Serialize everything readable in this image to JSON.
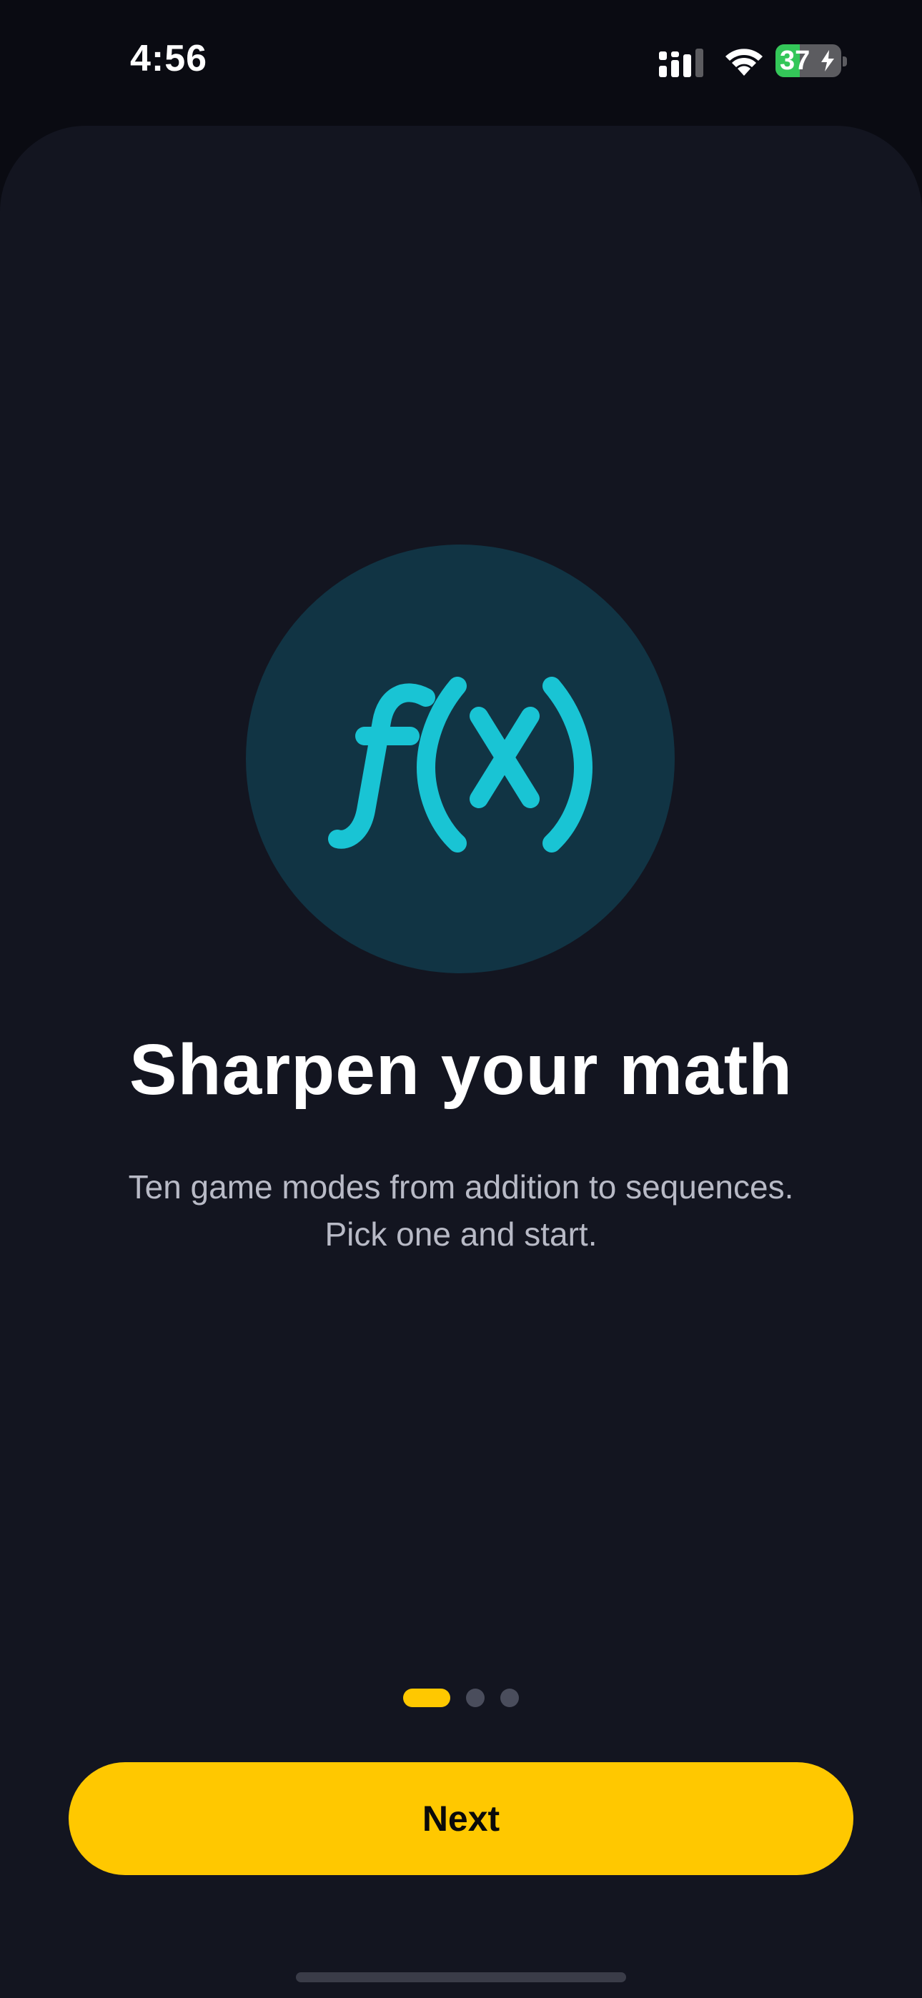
{
  "status_bar": {
    "time": "4:56",
    "battery_percent": "37",
    "battery_level": 0.37,
    "signal_icon": "signal-icon",
    "wifi_icon": "wifi-icon",
    "charging_icon": "bolt-icon"
  },
  "onboarding": {
    "hero_icon": "function-fx-icon",
    "title": "Sharpen your math",
    "subtitle_line1": "Ten game modes from addition to sequences.",
    "subtitle_line2": "Pick one and start.",
    "page_count": 3,
    "current_page": 1
  },
  "actions": {
    "next_label": "Next"
  },
  "colors": {
    "background": "#0a0b12",
    "sheet": "#131520",
    "accent": "#ffc800",
    "hero_circle": "#113444",
    "hero_glyph": "#19c4d4",
    "text_primary": "#ffffff",
    "text_secondary": "#b8bac6",
    "dot_inactive": "#4a4d5c"
  }
}
